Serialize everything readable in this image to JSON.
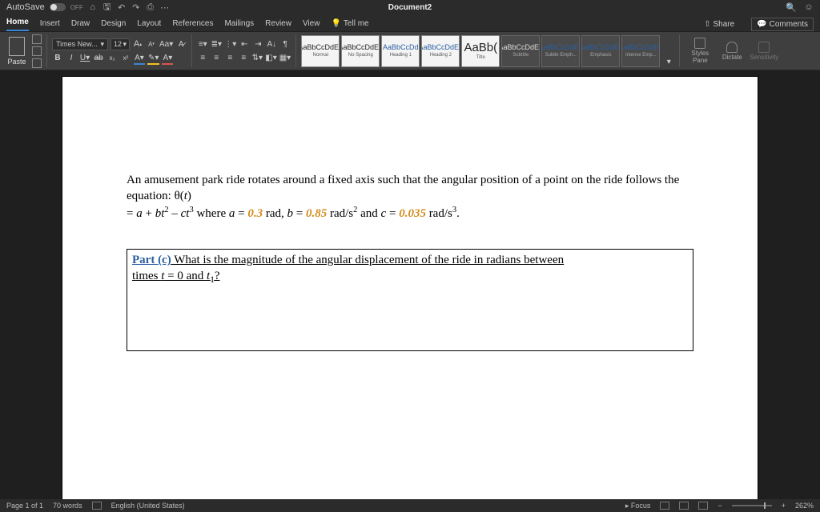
{
  "titlebar": {
    "autosave_label": "AutoSave",
    "autosave_state": "OFF",
    "doc_title": "Document2"
  },
  "tabs": {
    "items": [
      "Home",
      "Insert",
      "Draw",
      "Design",
      "Layout",
      "References",
      "Mailings",
      "Review",
      "View"
    ],
    "tell_me": "Tell me",
    "share": "Share",
    "comments": "Comments"
  },
  "ribbon": {
    "paste": "Paste",
    "font_name": "Times New...",
    "font_size": "12",
    "styles": [
      {
        "preview": "AaBbCcDdEe",
        "name": "Normal",
        "cls": ""
      },
      {
        "preview": "AaBbCcDdEe",
        "name": "No Spacing",
        "cls": ""
      },
      {
        "preview": "AaBbCcDd",
        "name": "Heading 1",
        "cls": "blue"
      },
      {
        "preview": "AaBbCcDdEe",
        "name": "Heading 2",
        "cls": "blue"
      },
      {
        "preview": "AaBb(",
        "name": "Title",
        "cls": ""
      },
      {
        "preview": "AaBbCcDdEe",
        "name": "Subtitle",
        "cls": "dark"
      },
      {
        "preview": "AaBbCcDdEe",
        "name": "Subtle Emph...",
        "cls": "dark ital"
      },
      {
        "preview": "AaBbCcDdEe",
        "name": "Emphasis",
        "cls": "dark ital"
      },
      {
        "preview": "AaBbCcDdEe",
        "name": "Intense Emp...",
        "cls": "dark ital"
      }
    ],
    "styles_pane": "Styles Pane",
    "dictate": "Dictate",
    "sensitivity": "Sensitivity"
  },
  "document": {
    "para1_a": "An amusement park ride rotates around a fixed axis such that the angular position of a point on the ride follows the equation: θ(",
    "para1_t": "t",
    "para1_b": ")",
    "para2_a": "= ",
    "para2_b": " + ",
    "para2_c": " – ",
    "para2_d": " where ",
    "a": "a",
    "b": "b",
    "c": "c",
    "t": "t",
    "eq": " = ",
    "val_a": "0.3",
    "unit_rad": " rad, ",
    "val_b": "0.85",
    "unit_b": " rad/s",
    "and": " and ",
    "val_c": "0.035",
    "unit_c": " rad/s",
    "period": ".",
    "part_label": "Part (c)",
    "part_q1": "  What is the magnitude of the angular displacement of the ride in radians between",
    "part_q2": "times ",
    "part_q3": " = 0 and ",
    "part_q4": "?",
    "t1": "t",
    "t1sub": "1"
  },
  "status": {
    "page": "Page 1 of 1",
    "words": "70 words",
    "lang": "English (United States)",
    "focus": "Focus",
    "zoom": "262%"
  }
}
